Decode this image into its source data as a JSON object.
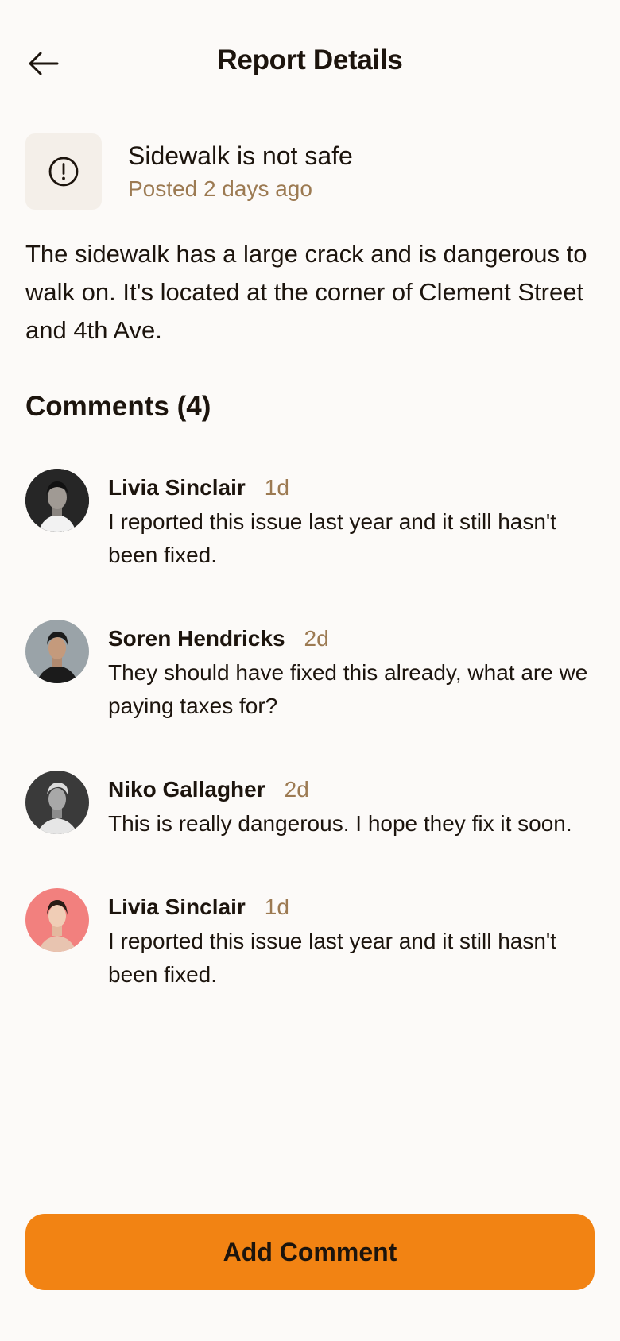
{
  "header": {
    "title": "Report Details",
    "back_icon": "arrow-left-icon"
  },
  "report": {
    "icon": "alert-circle-icon",
    "title": "Sidewalk is not safe",
    "posted": "Posted 2 days ago",
    "description": "The sidewalk has a large crack and is dangerous to walk on. It's located at the corner of Clement Street and 4th Ave."
  },
  "comments": {
    "heading": "Comments (4)",
    "items": [
      {
        "author": "Livia Sinclair",
        "time": "1d",
        "text": "I reported this issue last year and it still hasn't been fixed."
      },
      {
        "author": "Soren Hendricks",
        "time": "2d",
        "text": "They should have fixed this already, what are we paying taxes for?"
      },
      {
        "author": "Niko Gallagher",
        "time": "2d",
        "text": "This is really dangerous. I hope they fix it soon."
      },
      {
        "author": "Livia Sinclair",
        "time": "1d",
        "text": "I reported this issue last year and it still hasn't been fixed."
      }
    ]
  },
  "actions": {
    "add_comment_label": "Add Comment"
  },
  "colors": {
    "background": "#fcfaf8",
    "accent": "#f28313",
    "muted_text": "#9c7a52",
    "icon_box": "#f4efe9"
  }
}
